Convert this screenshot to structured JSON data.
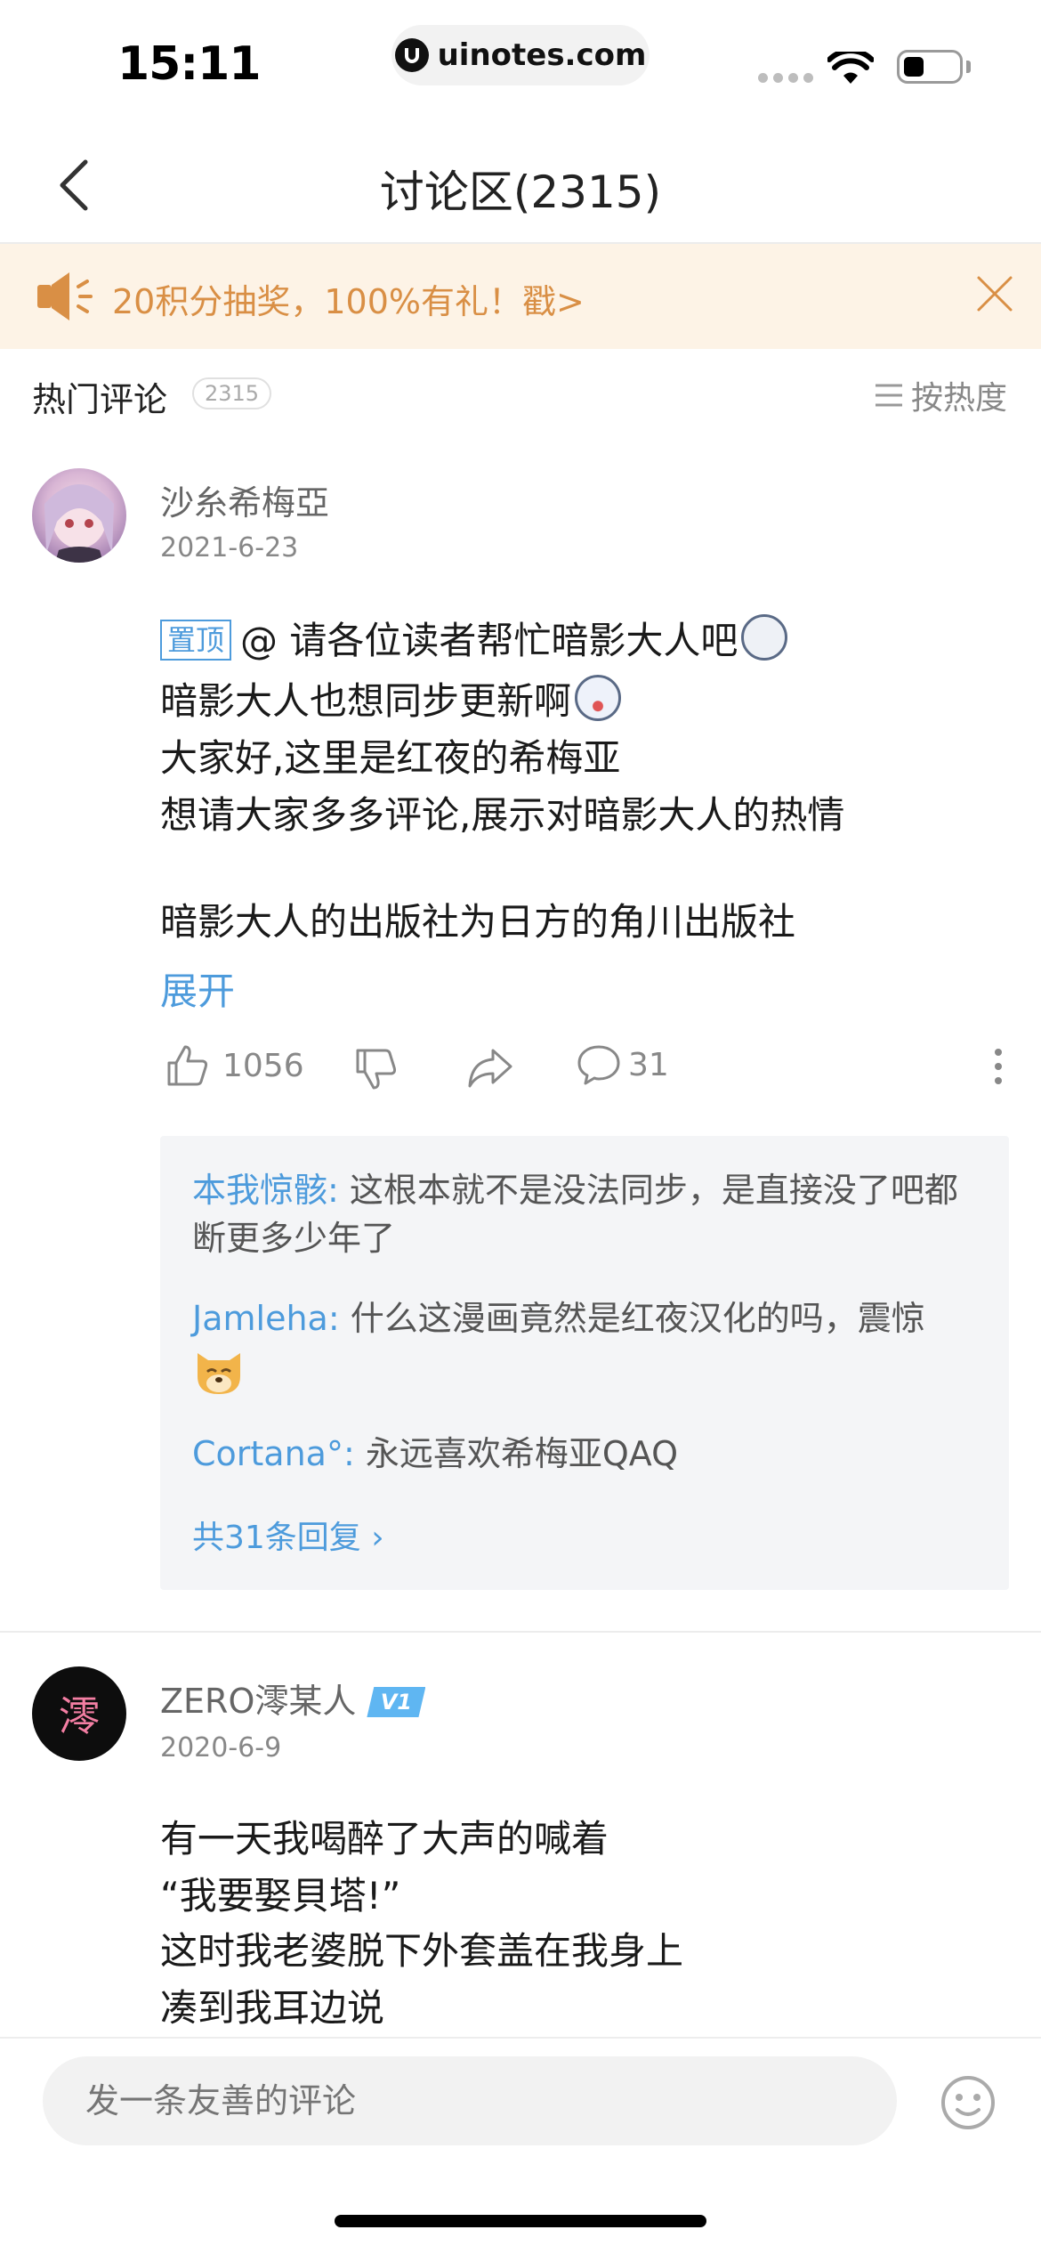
{
  "status_bar": {
    "time": "15:11",
    "url": "uinotes.com"
  },
  "nav": {
    "title": "讨论区(2315)"
  },
  "promo": {
    "text": "20积分抽奖，100%有礼！戳>",
    "color": "#d98f45"
  },
  "section": {
    "title": "热门评论",
    "count": "2315",
    "sort_label": "按热度"
  },
  "comment1": {
    "username": "沙糸希梅亞",
    "date": "2021-6-23",
    "pin_label": "置顶",
    "lines": [
      "@ 请各位读者帮忙暗影大人吧",
      "暗影大人也想同步更新啊",
      "大家好,这里是红夜的希梅亚",
      "想请大家多多评论,展示对暗影大人的热情",
      "暗影大人的出版社为日方的角川出版社"
    ],
    "expand_label": "展开",
    "like_count": "1056",
    "reply_count": "31",
    "replies": [
      {
        "user": "本我惊骸:",
        "text": " 这根本就不是没法同步，是直接没了吧都",
        "text2": "断更多少年了"
      },
      {
        "user": "Jamleha:",
        "text": " 什么这漫画竟然是红夜汉化的吗，震惊"
      },
      {
        "user": "Cortana°:",
        "text": " 永远喜欢希梅亚QAQ"
      }
    ],
    "more_replies": "共31条回复 ›"
  },
  "comment2": {
    "avatar_char": "澪",
    "username": "ZERO澪某人",
    "level": "V1",
    "date": "2020-6-9",
    "lines": [
      "有一天我喝醉了大声的喊着",
      "“我要娶貝塔!”",
      "这时我老婆脱下外套盖在我身上",
      "凑到我耳边说"
    ]
  },
  "input": {
    "placeholder": "发一条友善的评论"
  },
  "colors": {
    "accent_blue": "#4d9bdc",
    "promo_bg": "#fdf3e6"
  }
}
